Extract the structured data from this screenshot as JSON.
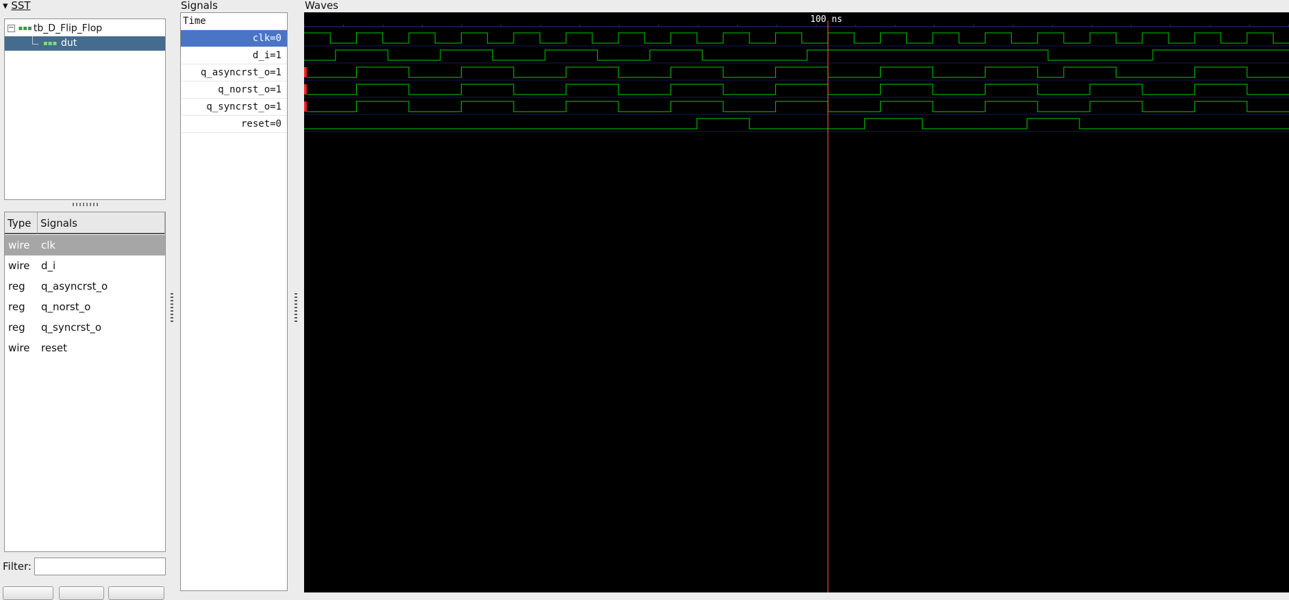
{
  "sst": {
    "title": "SST",
    "tree": [
      {
        "label": "tb_D_Flip_Flop",
        "expanded": true
      },
      {
        "label": "dut",
        "selected": true
      }
    ],
    "columns": {
      "type": "Type",
      "signals": "Signals"
    },
    "rows": [
      {
        "type": "wire",
        "name": "clk",
        "selected": true
      },
      {
        "type": "wire",
        "name": "d_i"
      },
      {
        "type": "reg",
        "name": "q_asyncrst_o"
      },
      {
        "type": "reg",
        "name": "q_norst_o"
      },
      {
        "type": "reg",
        "name": "q_syncrst_o"
      },
      {
        "type": "wire",
        "name": "reset"
      }
    ],
    "filter": {
      "label": "Filter:",
      "value": ""
    }
  },
  "signals_panel": {
    "title": "Signals",
    "header": "Time",
    "rows": [
      {
        "label": "clk=0",
        "selected": true
      },
      {
        "label": "d_i=1"
      },
      {
        "label": "q_asyncrst_o=1"
      },
      {
        "label": "q_norst_o=1"
      },
      {
        "label": "q_syncrst_o=1"
      },
      {
        "label": "reset=0"
      }
    ]
  },
  "waves": {
    "title": "Waves",
    "marker_label": "100 ns",
    "colors": {
      "background": "#000000",
      "trace": "#00d000",
      "grid": "#2a2a9a",
      "marker": "#ff6a3a",
      "unknown": "#ff2020",
      "text": "#ffffff"
    },
    "time_units_visible": 188,
    "marker_time": 100,
    "clock_period": 10,
    "signals": [
      {
        "name": "clk",
        "clock": true
      },
      {
        "name": "d_i",
        "initial": 0,
        "transitions": [
          6,
          16,
          26,
          36,
          46,
          56,
          66,
          76,
          96,
          142,
          162
        ]
      },
      {
        "name": "q_asyncrst_o",
        "initial": "x",
        "unknown_until": 0.5,
        "transitions": [
          0.5,
          10,
          20,
          30,
          40,
          50,
          60,
          70,
          80,
          90,
          100,
          110,
          120,
          130,
          140,
          145,
          155,
          170,
          180
        ]
      },
      {
        "name": "q_norst_o",
        "initial": "x",
        "unknown_until": 0.5,
        "transitions": [
          0.5,
          10,
          20,
          30,
          40,
          50,
          60,
          70,
          80,
          90,
          100,
          110,
          120,
          130,
          140,
          150,
          160,
          170,
          180
        ]
      },
      {
        "name": "q_syncrst_o",
        "initial": "x",
        "unknown_until": 0.5,
        "transitions": [
          0.5,
          10,
          20,
          30,
          40,
          50,
          60,
          70,
          80,
          90,
          100,
          110,
          120,
          130,
          140,
          150,
          160,
          170,
          180
        ]
      },
      {
        "name": "reset",
        "initial": 0,
        "transitions": [
          75,
          85,
          107,
          118,
          138,
          148
        ]
      }
    ]
  }
}
